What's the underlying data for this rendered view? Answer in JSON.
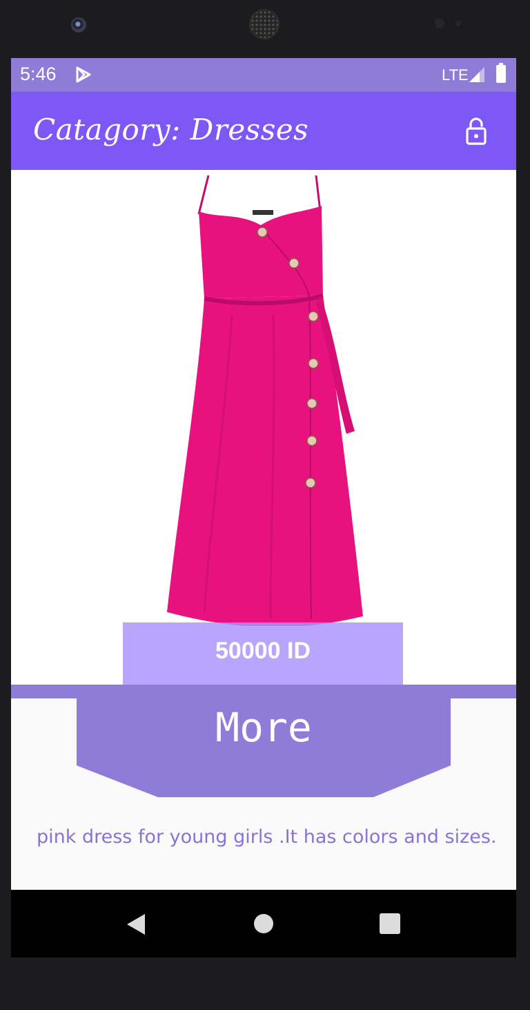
{
  "status_bar": {
    "time": "5:46",
    "network": "LTE",
    "icons": [
      "play-store-icon",
      "signal-icon",
      "battery-icon"
    ]
  },
  "app_bar": {
    "title": "Catagory: Dresses",
    "action_icon": "lock-open-icon",
    "background": "#7e57f7"
  },
  "product": {
    "image": "pink-button-front-midi-dress",
    "price": "50000 ID",
    "dress_color": "#e8127f"
  },
  "more_button": {
    "label": "More",
    "color": "#8f7bd8"
  },
  "description": "pink dress for young girls .It has colors and sizes.",
  "nav_bar": {
    "icons": [
      "back-icon",
      "home-icon",
      "recents-icon"
    ]
  }
}
